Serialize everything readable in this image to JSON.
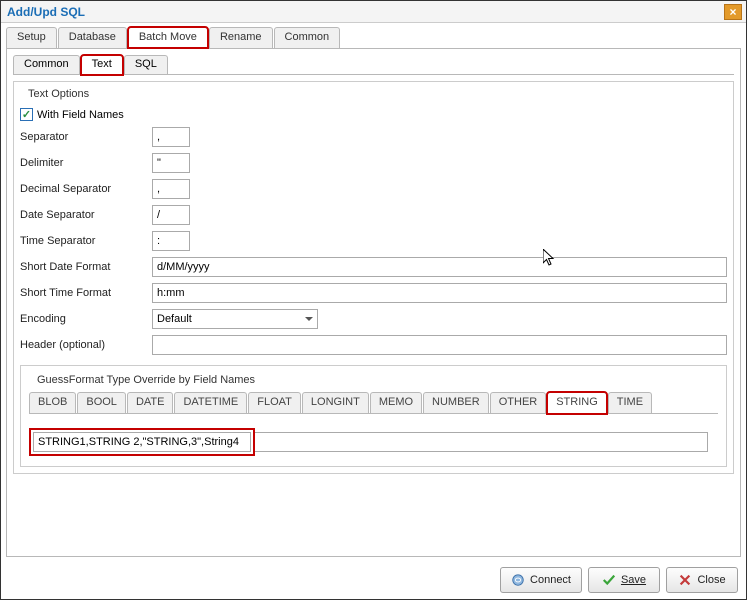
{
  "title": "Add/Upd SQL",
  "mainTabs": [
    "Setup",
    "Database",
    "Batch Move",
    "Rename",
    "Common"
  ],
  "activeMainTab": "Batch Move",
  "subTabs": [
    "Common",
    "Text",
    "SQL"
  ],
  "activeSubTab": "Text",
  "textOptions": {
    "groupTitle": "Text Options",
    "withFieldNamesLabel": "With Field Names",
    "withFieldNamesChecked": true,
    "separator": {
      "label": "Separator",
      "value": ","
    },
    "delimiter": {
      "label": "Delimiter",
      "value": "\""
    },
    "decimalSeparator": {
      "label": "Decimal Separator",
      "value": ","
    },
    "dateSeparator": {
      "label": "Date Separator",
      "value": "/"
    },
    "timeSeparator": {
      "label": "Time Separator",
      "value": ":"
    },
    "shortDateFormat": {
      "label": "Short Date Format",
      "value": "d/MM/yyyy"
    },
    "shortTimeFormat": {
      "label": "Short Time Format",
      "value": "h:mm"
    },
    "encoding": {
      "label": "Encoding",
      "value": "Default"
    },
    "header": {
      "label": "Header (optional)",
      "value": ""
    }
  },
  "guessFormat": {
    "groupTitle": "GuessFormat Type Override by Field Names",
    "typeTabs": [
      "BLOB",
      "BOOL",
      "DATE",
      "DATETIME",
      "FLOAT",
      "LONGINT",
      "MEMO",
      "NUMBER",
      "OTHER",
      "STRING",
      "TIME"
    ],
    "activeTypeTab": "STRING",
    "overrideValue": "STRING1,STRING 2,\"STRING,3\",String4"
  },
  "footer": {
    "connect": "Connect",
    "save": "Save",
    "close": "Close"
  }
}
